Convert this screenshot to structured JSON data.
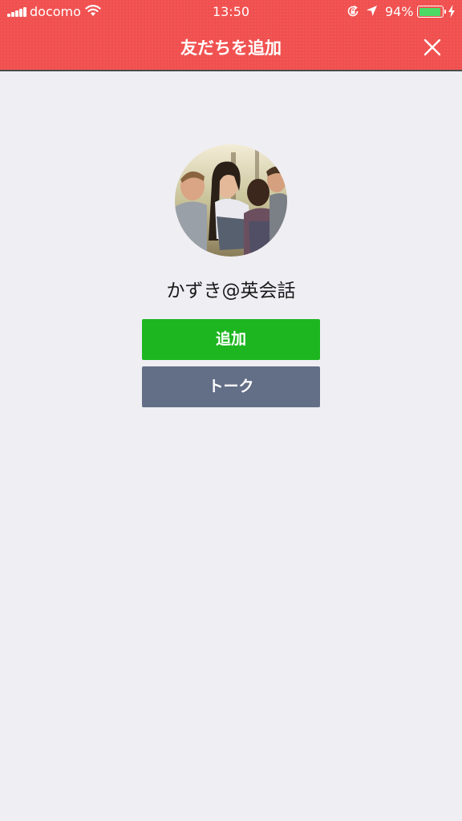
{
  "status_bar": {
    "carrier": "docomo",
    "time": "13:50",
    "battery_percent": "94%",
    "battery_level": 0.94,
    "battery_color": "#4cd964"
  },
  "header": {
    "title": "友だちを追加",
    "close_icon": "close-icon",
    "background_color": "#f0504f"
  },
  "profile": {
    "name": "かずき@英会話"
  },
  "actions": {
    "add_label": "追加",
    "add_color": "#1db620",
    "talk_label": "トーク",
    "talk_color": "#636e87"
  }
}
